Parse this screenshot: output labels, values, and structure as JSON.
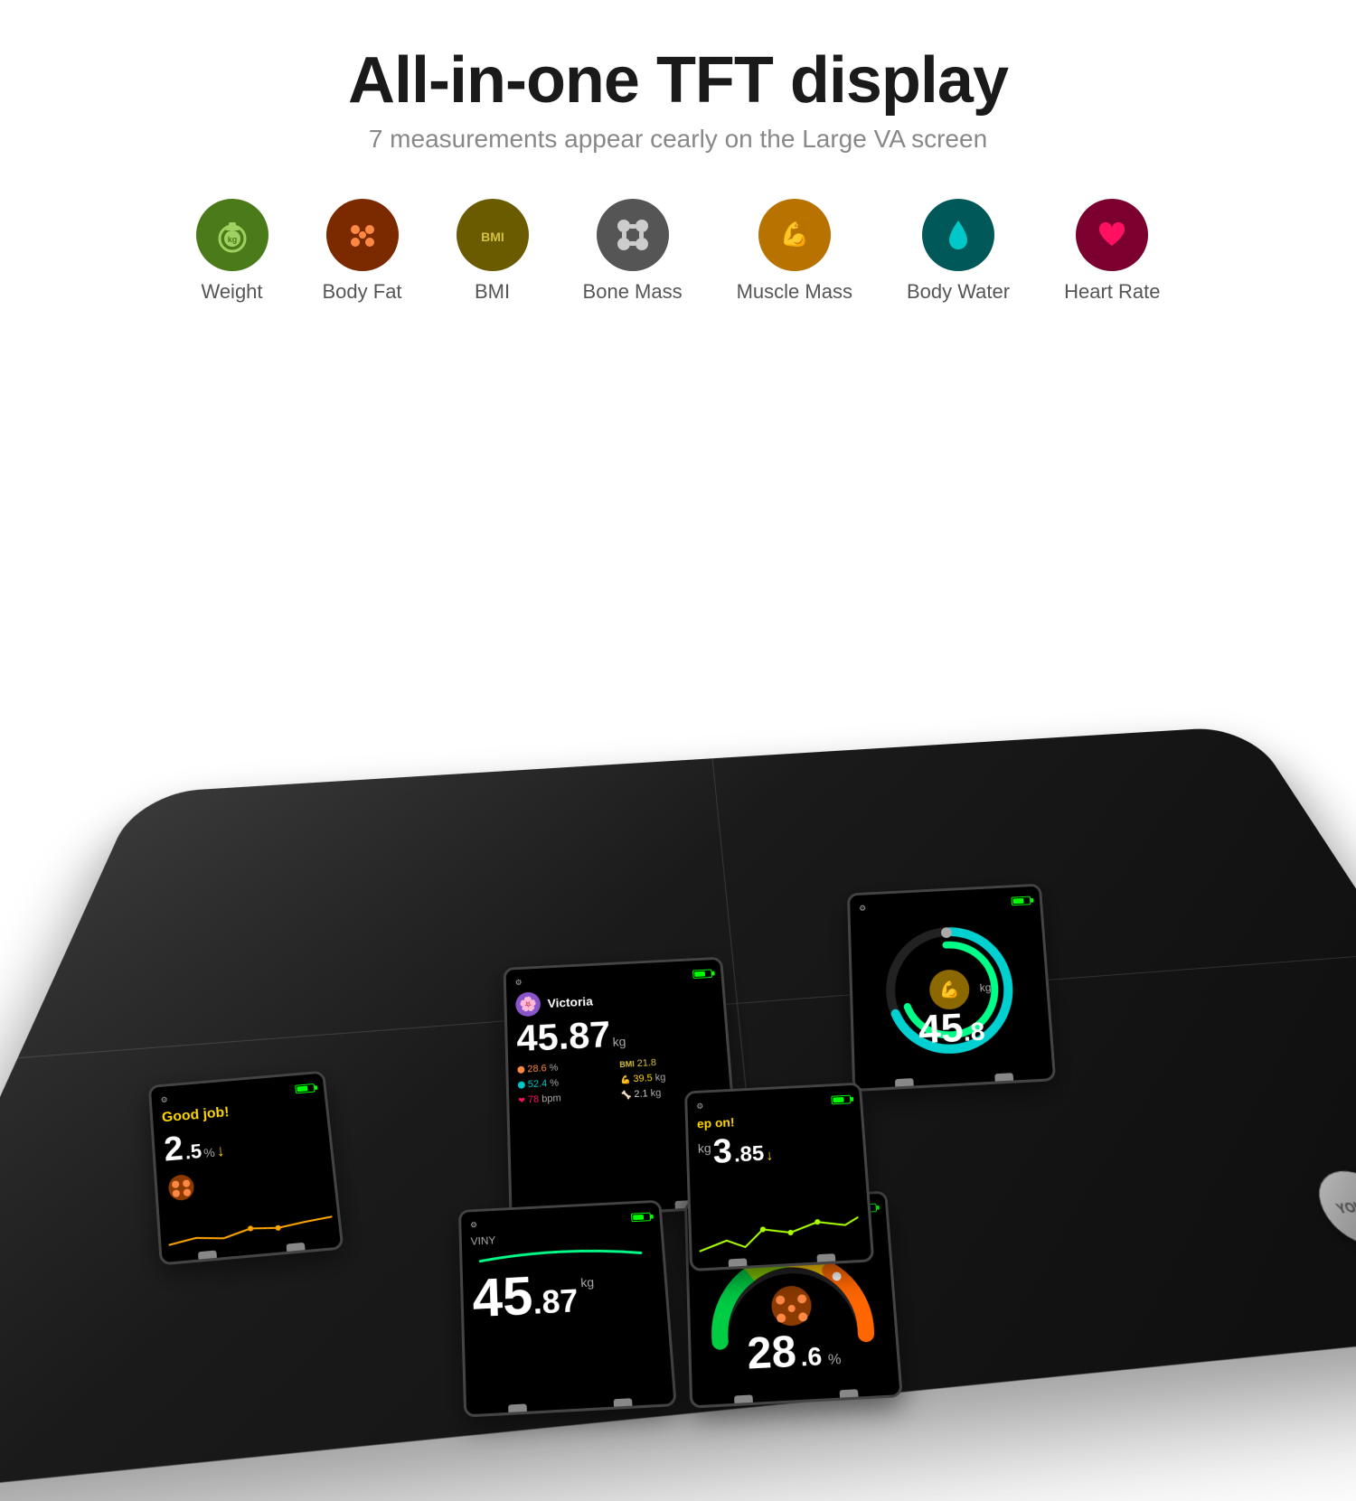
{
  "header": {
    "title": "All-in-one TFT display",
    "subtitle": "7 measurements appear cearly on the Large VA screen"
  },
  "icons": [
    {
      "id": "weight",
      "label": "Weight",
      "color": "#5a8a2a",
      "icon": "⚖",
      "bg": "#4a7a1a"
    },
    {
      "id": "bodyfat",
      "label": "Body Fat",
      "color": "#8b3a00",
      "icon": "●●●",
      "bg": "#7b2a00"
    },
    {
      "id": "bmi",
      "label": "BMI",
      "color": "#7a6a00",
      "icon": "BMI",
      "bg": "#6a5a00"
    },
    {
      "id": "bonemass",
      "label": "Bone Mass",
      "color": "#666",
      "icon": "🦴",
      "bg": "#555"
    },
    {
      "id": "musclemass",
      "label": "Muscle Mass",
      "color": "#c8820a",
      "icon": "💪",
      "bg": "#b87200"
    },
    {
      "id": "bodywater",
      "label": "Body Water",
      "color": "#006868",
      "icon": "💧",
      "bg": "#005858"
    },
    {
      "id": "heartrate",
      "label": "Heart Rate",
      "color": "#8b0040",
      "icon": "❤",
      "bg": "#7b0030"
    }
  ],
  "screens": {
    "muscle": {
      "value": "45",
      "decimal": ".8",
      "unit": "kg",
      "gauge_color_start": "#00d0d0",
      "gauge_color_end": "#00ff88"
    },
    "main": {
      "user": "Victoria",
      "weight": "45.87",
      "weight_unit": "kg",
      "bmi_label": "BMI",
      "bmi_value": "21.8",
      "bodyfat_value": "28.6",
      "bodyfat_unit": "%",
      "muscle_value": "39.5",
      "muscle_unit": "kg",
      "water_value": "52.4",
      "water_unit": "%",
      "heartrate_value": "78",
      "heartrate_unit": "bpm",
      "bonemass_value": "2.1",
      "bonemass_unit": "kg"
    },
    "goodjob": {
      "message": "Good job!",
      "value": "2",
      "decimal": ".5",
      "unit": "%",
      "arrow": "↓"
    },
    "weight": {
      "user": "VINY",
      "value": "45",
      "decimal": ".87",
      "unit": "kg"
    },
    "fat": {
      "value": "28",
      "decimal": ".6",
      "unit": "%"
    },
    "small": {
      "message": "ep on!",
      "value": "3",
      "decimal": ".85",
      "unit": "kg",
      "arrow": "↓"
    }
  },
  "logo": "YOUSA"
}
